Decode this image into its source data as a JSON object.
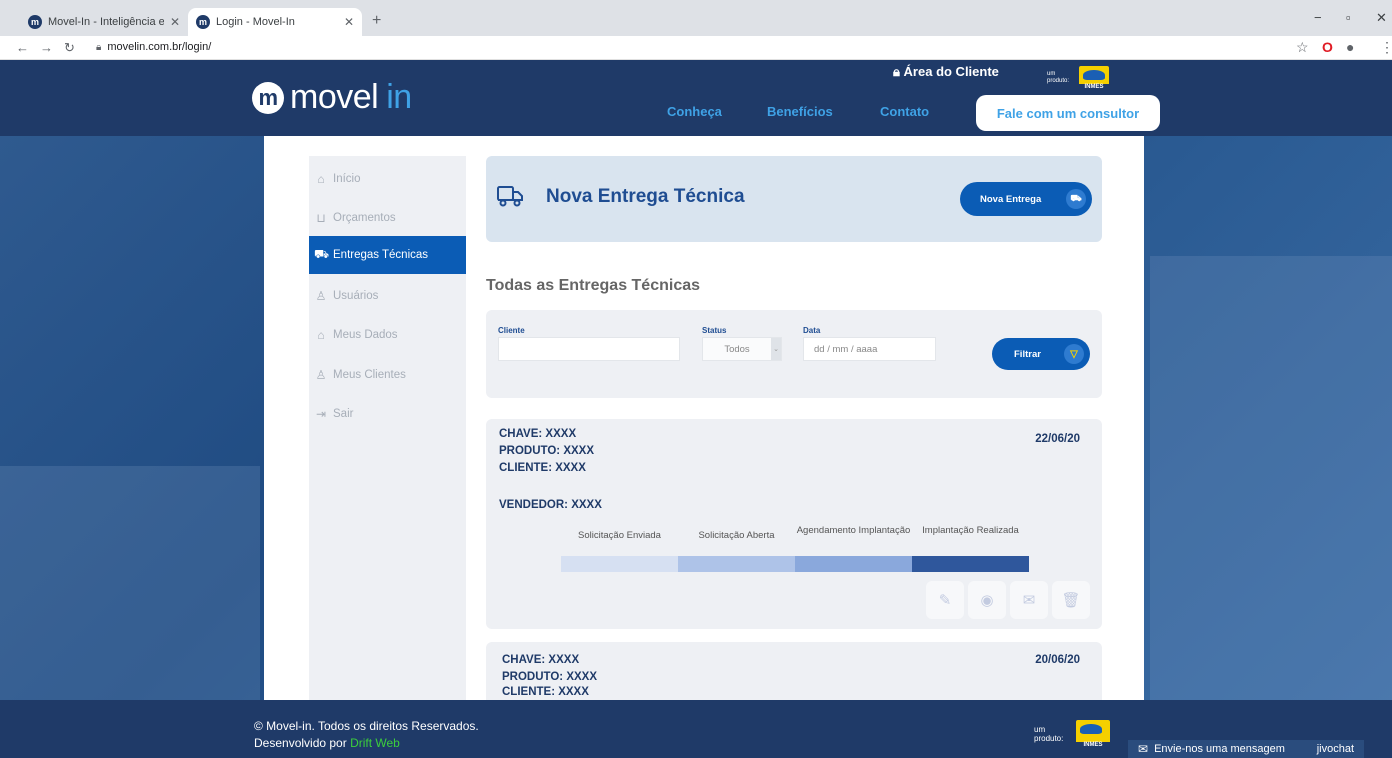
{
  "browser": {
    "tabs": [
      {
        "title": "Movel-In - Inteligência e tecnolo",
        "close": "✕"
      },
      {
        "title": "Login - Movel-In",
        "close": "✕"
      }
    ],
    "new_tab": "+",
    "url": "movelin.com.br/login/",
    "window_controls": [
      "−",
      "▫",
      "✕"
    ]
  },
  "header": {
    "logo_main": "movel",
    "logo_accent": "in",
    "logo_badge": "m",
    "area_cliente": "Área do Cliente",
    "product_of": "um produto:",
    "inmes": "INMES",
    "nav": [
      "Conheça",
      "Benefícios",
      "Contato"
    ],
    "cta": "Fale com um consultor"
  },
  "sidebar": {
    "items": [
      {
        "label": "Início",
        "icon": "home-icon",
        "glyph": "⌂"
      },
      {
        "label": "Orçamentos",
        "icon": "cart-icon",
        "glyph": "⊔"
      },
      {
        "label": "Entregas Técnicas",
        "icon": "truck-icon",
        "glyph": "⛟"
      },
      {
        "label": "Usuários",
        "icon": "user-icon",
        "glyph": "♙"
      },
      {
        "label": "Meus Dados",
        "icon": "lock-icon",
        "glyph": "⌂"
      },
      {
        "label": "Meus Clientes",
        "icon": "users-icon",
        "glyph": "♙"
      },
      {
        "label": "Sair",
        "icon": "logout-icon",
        "glyph": "⇥"
      }
    ],
    "active_index": 2
  },
  "page": {
    "title": "Nova Entrega Técnica",
    "new_button": "Nova Entrega",
    "section_title": "Todas as Entregas Técnicas"
  },
  "filters": {
    "cliente_label": "Cliente",
    "cliente_value": "",
    "status_label": "Status",
    "status_value": "Todos",
    "data_label": "Data",
    "data_placeholder": "dd / mm / aaaa",
    "filter_button": "Filtrar"
  },
  "entries": [
    {
      "chave": "CHAVE: XXXX",
      "produto": "PRODUTO: XXXX",
      "cliente": "CLIENTE: XXXX",
      "vendedor": "VENDEDOR: XXXX",
      "date": "22/06/20",
      "steps": [
        {
          "label": "Solicitação Enviada",
          "color": "#d6e0f2"
        },
        {
          "label": "Solicitação Aberta",
          "color": "#aec3e8"
        },
        {
          "label": "Agendamento Implantação",
          "color": "#8aa8dc"
        },
        {
          "label": "Implantação Realizada",
          "color": "#2f579c"
        }
      ]
    },
    {
      "chave": "CHAVE: XXXX",
      "produto": "PRODUTO: XXXX",
      "cliente": "CLIENTE: XXXX",
      "date": "20/06/20"
    }
  ],
  "footer": {
    "copyright": "© Movel-in. Todos os direitos Reservados.",
    "developed_by": "Desenvolvido por ",
    "developer": "Drift Web",
    "product_of": "um produto:",
    "inmes": "INMES"
  },
  "chat": {
    "label": "Envie-nos uma mensagem",
    "brand": "jivochat"
  },
  "colors": {
    "brand_dark": "#1f3a68",
    "brand_light": "#3fa2e6",
    "primary_button": "#0b5cb5"
  }
}
